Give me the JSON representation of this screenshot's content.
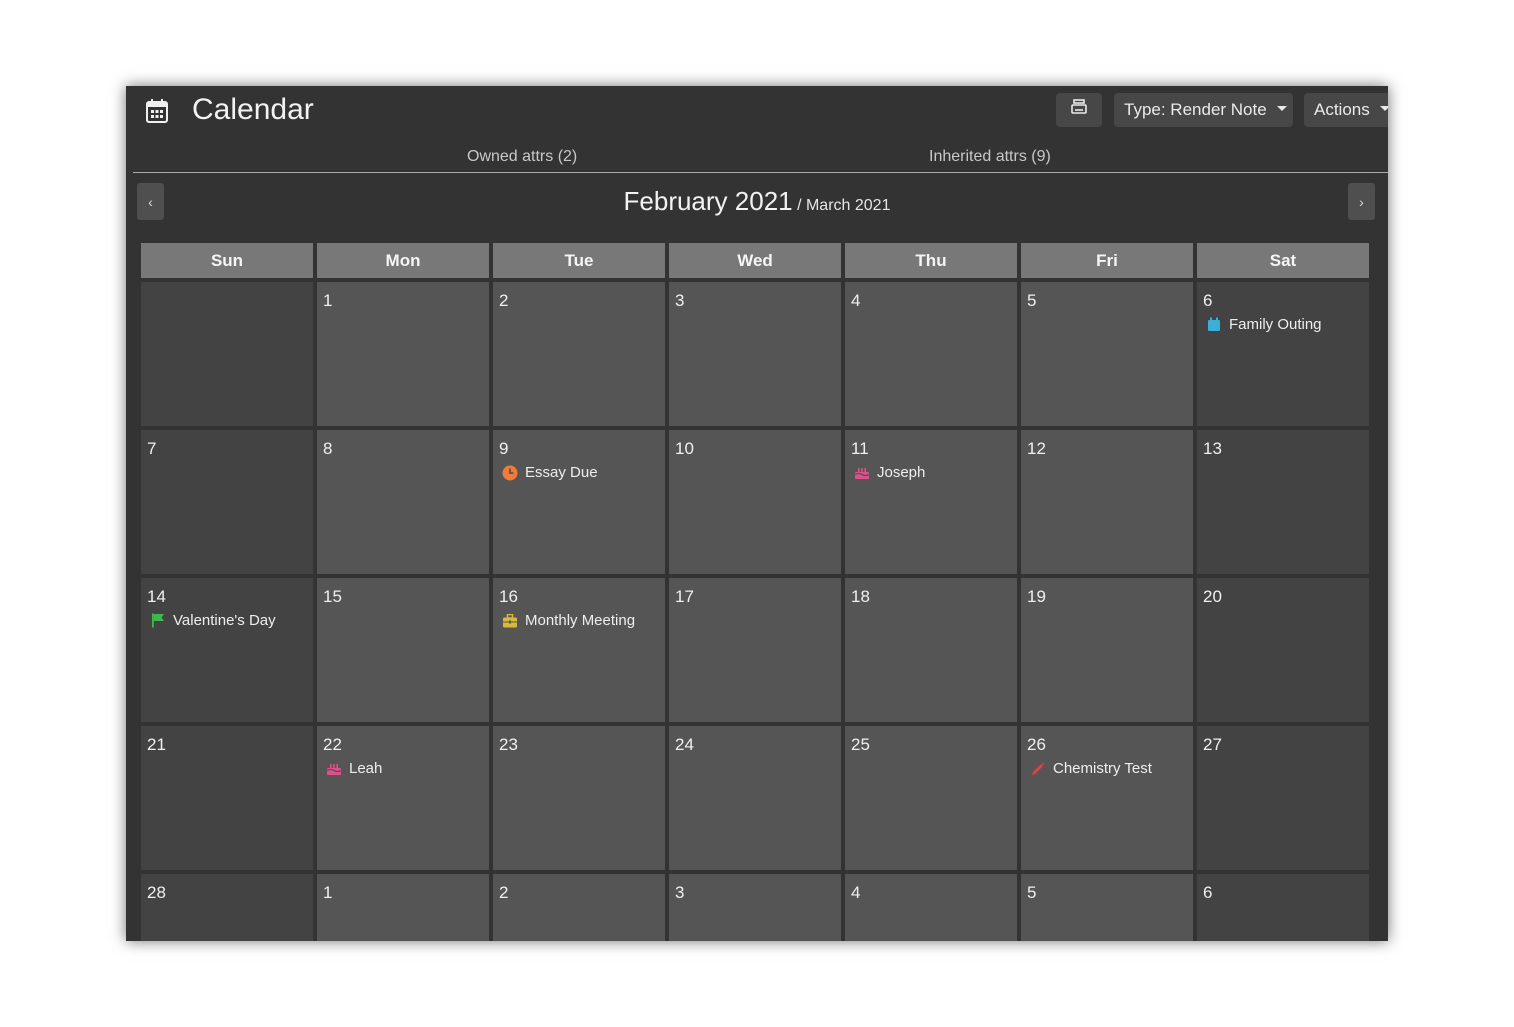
{
  "header": {
    "title": "Calendar",
    "type_label": "Type: Render Note",
    "actions_label": "Actions"
  },
  "attr_tabs": {
    "owned": "Owned attrs (2)",
    "inherited": "Inherited attrs (9)"
  },
  "calendar": {
    "month_main": "February 2021",
    "month_sub": "/ March 2021",
    "prev_label": "‹",
    "next_label": "›",
    "weekdays": [
      "Sun",
      "Mon",
      "Tue",
      "Wed",
      "Thu",
      "Fri",
      "Sat"
    ],
    "weeks": [
      [
        {
          "day": ""
        },
        {
          "day": "1"
        },
        {
          "day": "2"
        },
        {
          "day": "3"
        },
        {
          "day": "4"
        },
        {
          "day": "5"
        },
        {
          "day": "6",
          "event": {
            "label": "Family Outing",
            "icon": "calendar-icon",
            "color": "#3ab0d8"
          }
        }
      ],
      [
        {
          "day": "7"
        },
        {
          "day": "8"
        },
        {
          "day": "9",
          "event": {
            "label": "Essay Due",
            "icon": "clock-icon",
            "color": "#f07b3a"
          }
        },
        {
          "day": "10"
        },
        {
          "day": "11",
          "event": {
            "label": "Joseph",
            "icon": "cake-icon",
            "color": "#e04f8a"
          }
        },
        {
          "day": "12"
        },
        {
          "day": "13"
        }
      ],
      [
        {
          "day": "14",
          "event": {
            "label": "Valentine's Day",
            "icon": "flag-icon",
            "color": "#3fba4a"
          }
        },
        {
          "day": "15"
        },
        {
          "day": "16",
          "event": {
            "label": "Monthly Meeting",
            "icon": "briefcase-icon",
            "color": "#d9b93a"
          }
        },
        {
          "day": "17"
        },
        {
          "day": "18"
        },
        {
          "day": "19"
        },
        {
          "day": "20"
        }
      ],
      [
        {
          "day": "21"
        },
        {
          "day": "22",
          "event": {
            "label": "Leah",
            "icon": "cake-icon",
            "color": "#e04f8a"
          }
        },
        {
          "day": "23"
        },
        {
          "day": "24"
        },
        {
          "day": "25"
        },
        {
          "day": "26",
          "event": {
            "label": "Chemistry Test",
            "icon": "pencil-icon",
            "color": "#e84040"
          }
        },
        {
          "day": "27"
        }
      ],
      [
        {
          "day": "28"
        },
        {
          "day": "1"
        },
        {
          "day": "2"
        },
        {
          "day": "3"
        },
        {
          "day": "4"
        },
        {
          "day": "5"
        },
        {
          "day": "6"
        }
      ]
    ]
  }
}
